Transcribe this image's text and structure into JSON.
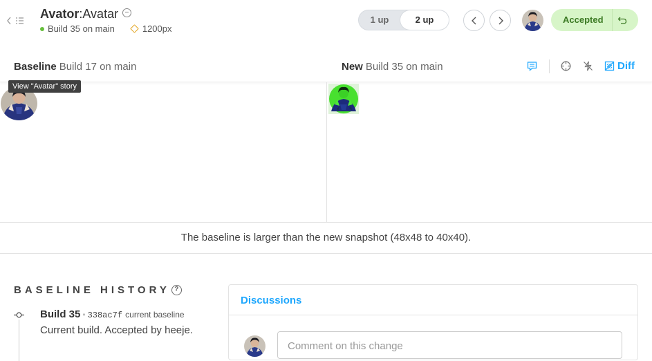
{
  "header": {
    "component": "Avator",
    "separator": ":",
    "story": "Avatar",
    "build_label": "Build 35 on main",
    "viewport": "1200px"
  },
  "view_toggle": {
    "options": [
      "1 up",
      "2 up"
    ],
    "selected": "2 up"
  },
  "status": {
    "label": "Accepted"
  },
  "comparison": {
    "baseline_label": "Baseline",
    "baseline_build": "Build 17 on main",
    "new_label": "New",
    "new_build": "Build 35 on main",
    "diff_label": "Diff"
  },
  "tooltip": "View \"Avatar\" story",
  "notice": "The baseline is larger than the new snapshot (48x48 to 40x40).",
  "history": {
    "title": "BASELINE HISTORY",
    "help": "?",
    "entries": [
      {
        "build": "Build 35",
        "hash": "338ac7f",
        "tag": "current baseline",
        "description": "Current build. Accepted by heeje."
      }
    ]
  },
  "discussions": {
    "title": "Discussions",
    "comment_placeholder": "Comment on this change"
  },
  "colors": {
    "accent": "#1ea7fd",
    "accepted_bg": "#d7f5c8",
    "accepted_text": "#3c7a24",
    "diff_green": "#4ee63a"
  }
}
